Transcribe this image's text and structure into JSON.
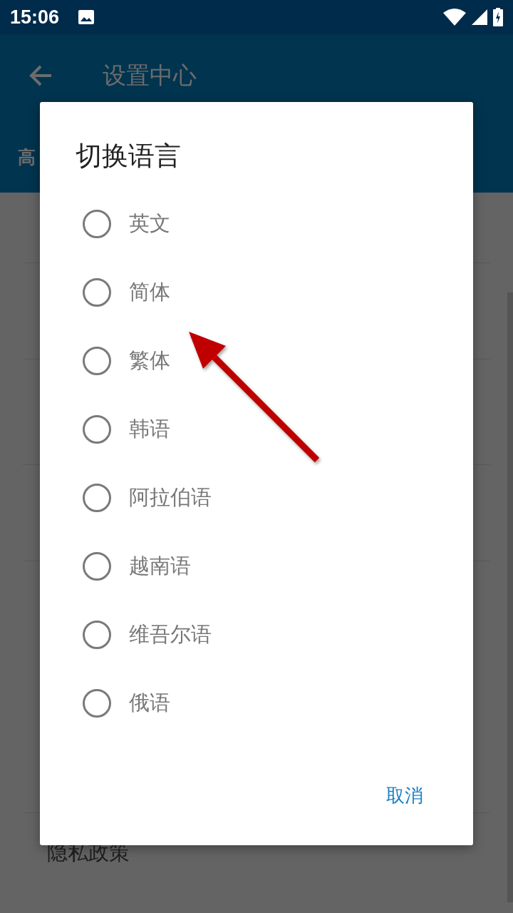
{
  "status_bar": {
    "time": "15:06"
  },
  "app_bar": {
    "title": "设置中心",
    "tab_label": "高"
  },
  "background_list": {
    "last_item": "隐私政策"
  },
  "dialog": {
    "title": "切换语言",
    "options": [
      {
        "label": "英文",
        "selected": false
      },
      {
        "label": "简体",
        "selected": false
      },
      {
        "label": "繁体",
        "selected": false
      },
      {
        "label": "韩语",
        "selected": false
      },
      {
        "label": "阿拉伯语",
        "selected": false
      },
      {
        "label": "越南语",
        "selected": false
      },
      {
        "label": "维吾尔语",
        "selected": false
      },
      {
        "label": "俄语",
        "selected": false
      }
    ],
    "buttons": [
      "取消"
    ]
  }
}
